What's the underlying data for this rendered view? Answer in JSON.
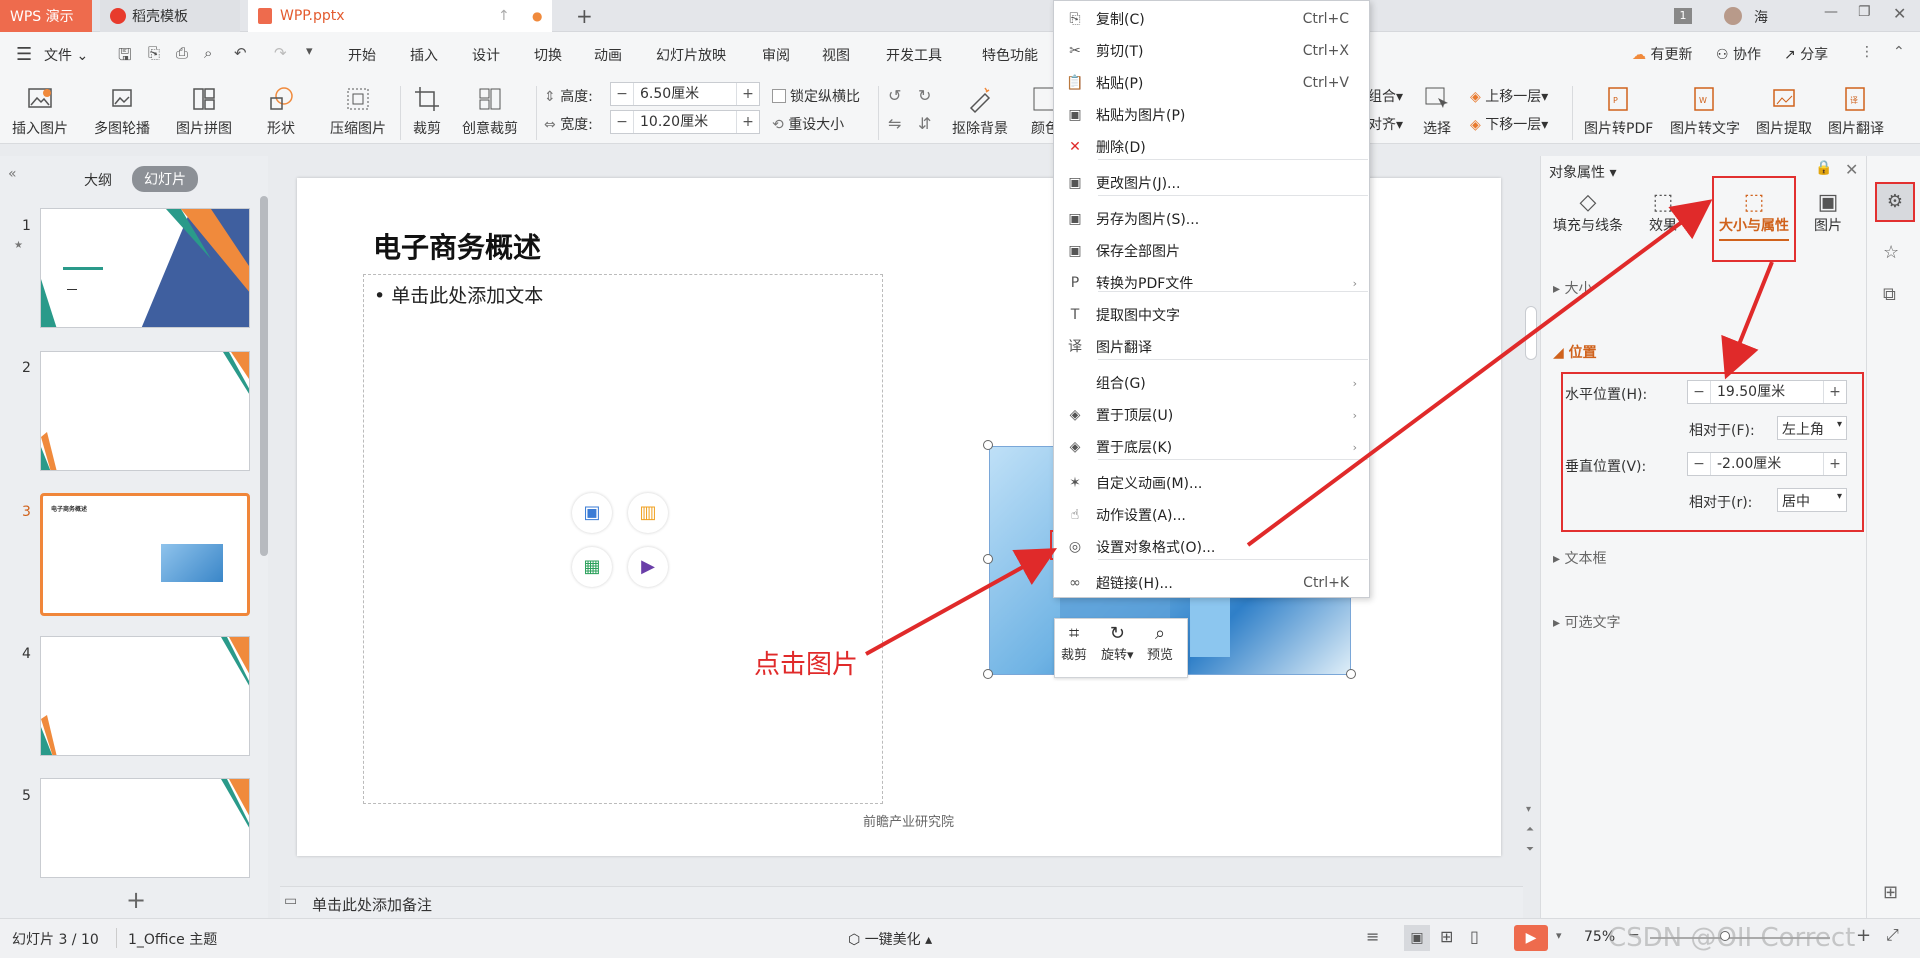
{
  "tabs": {
    "app": "WPS 演示",
    "template": "稻壳模板",
    "file": "WPP.pptx",
    "new": "+"
  },
  "titlebar": {
    "badge": "1",
    "user": "海"
  },
  "menu": {
    "file": "文件",
    "items": [
      "开始",
      "插入",
      "设计",
      "切换",
      "动画",
      "幻灯片放映",
      "审阅",
      "视图",
      "开发工具",
      "特色功能"
    ],
    "update": "有更新",
    "collab": "协作",
    "share": "分享"
  },
  "ribbon": {
    "insert_pic": "插入图片",
    "carousel": "多图轮播",
    "collage": "图片拼图",
    "shape": "形状",
    "compress": "压缩图片",
    "crop": "裁剪",
    "creative_crop": "创意裁剪",
    "height_label": "高度:",
    "height_value": "6.50厘米",
    "width_label": "宽度:",
    "width_value": "10.20厘米",
    "lock_ratio": "锁定纵横比",
    "reset_size": "重设大小",
    "remove_bg": "抠除背景",
    "color": "颜色",
    "group": "组合",
    "align": "对齐",
    "select": "选择",
    "bring_up": "上移一层",
    "send_down": "下移一层",
    "pic_to_pdf": "图片转PDF",
    "pic_to_text": "图片转文字",
    "pic_extract": "图片提取",
    "pic_translate": "图片翻译"
  },
  "leftpane": {
    "outline_tab": "大纲",
    "slides_tab": "幻灯片",
    "slide_numbers": [
      "1",
      "2",
      "3",
      "4",
      "5"
    ],
    "slide3_title": "电子商务概述",
    "add": "+"
  },
  "slide": {
    "title": "电子商务概述",
    "bullet": "单击此处添加文本",
    "footer": "前瞻产业研究院"
  },
  "notes": {
    "placeholder": "单击此处添加备注"
  },
  "image_toolbar": {
    "crop": "裁剪",
    "rotate": "旋转",
    "preview": "预览"
  },
  "annotation": {
    "text": "点击图片"
  },
  "context_menu": [
    {
      "label": "复制(C)",
      "shortcut": "Ctrl+C",
      "icon": "copy-icon"
    },
    {
      "label": "剪切(T)",
      "shortcut": "Ctrl+X",
      "icon": "cut-icon"
    },
    {
      "label": "粘贴(P)",
      "shortcut": "Ctrl+V",
      "icon": "paste-icon"
    },
    {
      "label": "粘贴为图片(P)",
      "shortcut": "",
      "icon": "paste-image-icon"
    },
    {
      "label": "删除(D)",
      "shortcut": "",
      "icon": "delete-icon"
    },
    {
      "label": "更改图片(J)...",
      "shortcut": "",
      "icon": "change-image-icon"
    },
    {
      "label": "另存为图片(S)...",
      "shortcut": "",
      "icon": "save-image-icon"
    },
    {
      "label": "保存全部图片",
      "shortcut": "",
      "icon": "save-all-icon"
    },
    {
      "label": "转换为PDF文件",
      "shortcut": "",
      "icon": "pdf-icon",
      "submenu": true
    },
    {
      "label": "提取图中文字",
      "shortcut": "",
      "icon": "ocr-icon"
    },
    {
      "label": "图片翻译",
      "shortcut": "",
      "icon": "translate-icon"
    },
    {
      "label": "组合(G)",
      "shortcut": "",
      "icon": "",
      "submenu": true
    },
    {
      "label": "置于顶层(U)",
      "shortcut": "",
      "icon": "layer-top-icon",
      "submenu": true
    },
    {
      "label": "置于底层(K)",
      "shortcut": "",
      "icon": "layer-bottom-icon",
      "submenu": true
    },
    {
      "label": "自定义动画(M)...",
      "shortcut": "",
      "icon": "animation-icon"
    },
    {
      "label": "动作设置(A)...",
      "shortcut": "",
      "icon": "action-icon"
    },
    {
      "label": "设置对象格式(O)...",
      "shortcut": "",
      "icon": "format-object-icon"
    },
    {
      "label": "超链接(H)...",
      "shortcut": "Ctrl+K",
      "icon": "hyperlink-icon"
    }
  ],
  "panel": {
    "title": "对象属性",
    "tabs": [
      "填充与线条",
      "效果",
      "大小与属性",
      "图片"
    ],
    "sections": {
      "size": "大小",
      "position": "位置",
      "textbox": "文本框",
      "alt_text": "可选文字"
    },
    "h_pos_label": "水平位置(H):",
    "h_pos_value": "19.50厘米",
    "relative_label_f": "相对于(F):",
    "relative_f_value": "左上角",
    "v_pos_label": "垂直位置(V):",
    "v_pos_value": "-2.00厘米",
    "relative_label_r": "相对于(r):",
    "relative_r_value": "居中"
  },
  "status": {
    "slide_info": "幻灯片 3 / 10",
    "theme": "1_Office 主题",
    "beautify": "一键美化",
    "zoom": "75%",
    "watermark": "CSDN @OII Correct"
  },
  "colors": {
    "accent": "#d0621c",
    "red": "#e02a2a",
    "wps_red": "#ee6b4d"
  }
}
